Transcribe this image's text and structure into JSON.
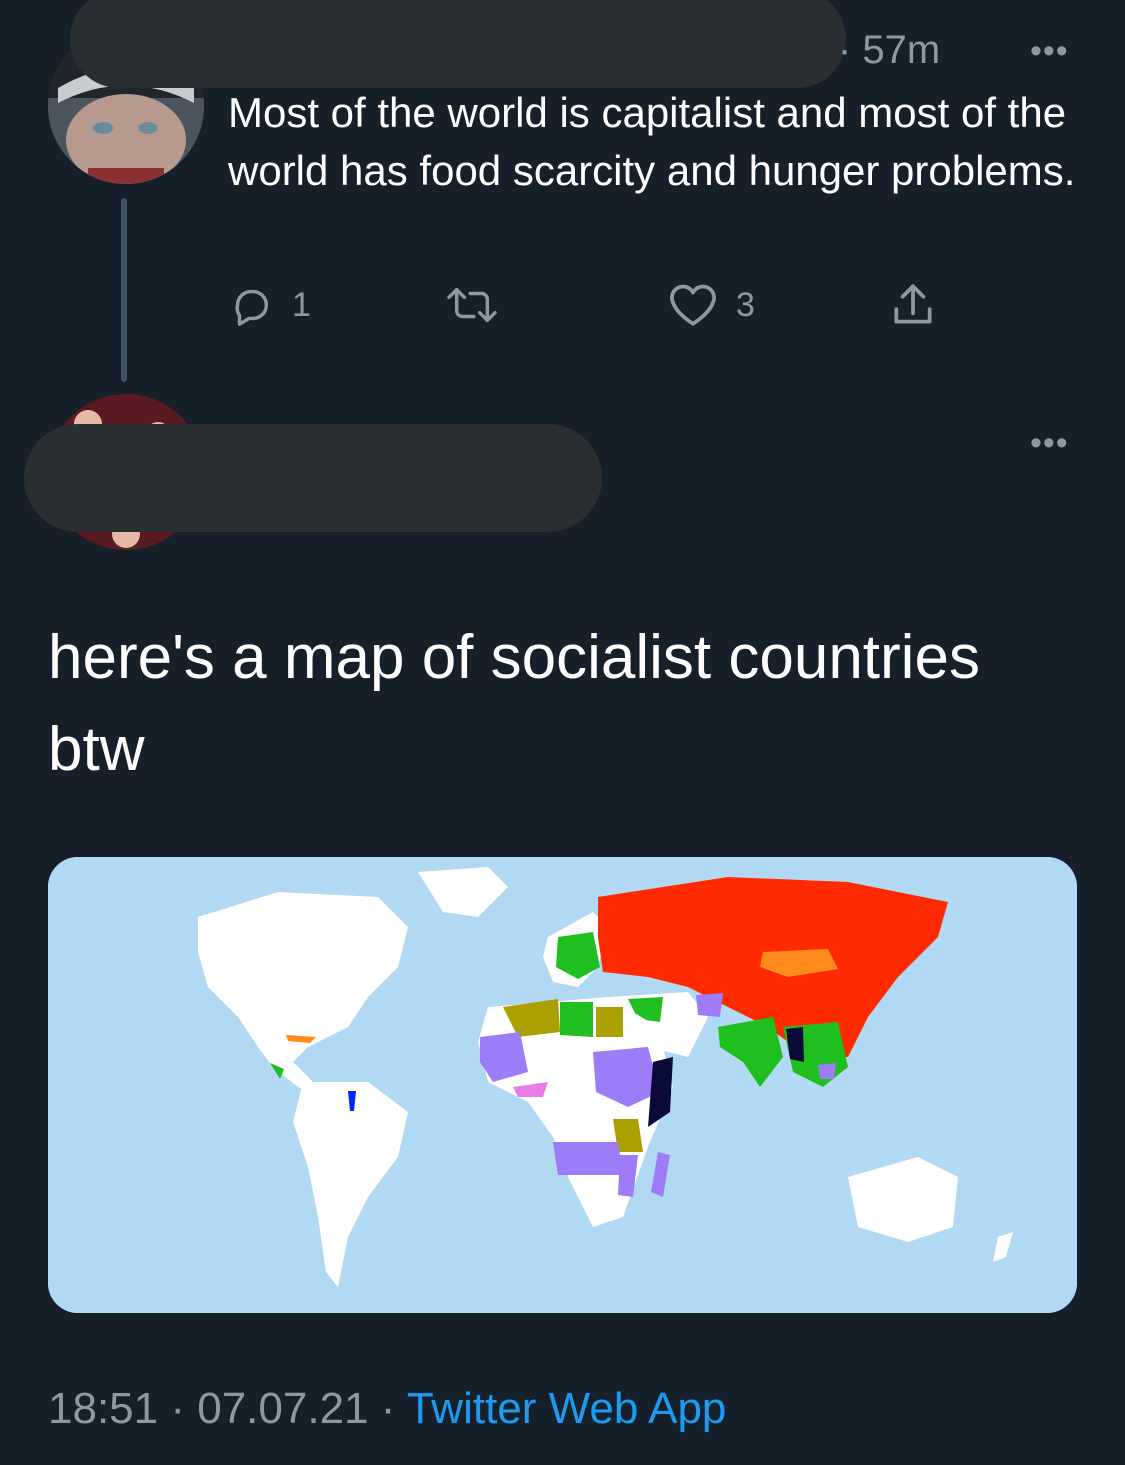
{
  "reply_to_tweet": {
    "timestamp": "· 57m",
    "more_glyph": "•••",
    "text": "Most of the world is capitalist and most of the world has food scarcity and hunger problems.",
    "actions": {
      "reply_count": "1",
      "retweet_count": "",
      "like_count": "3"
    }
  },
  "main_tweet": {
    "more_glyph": "•••",
    "text": "here's a map of socialist countries btw",
    "map_image": {
      "colors": {
        "ocean": "#b2d9f3",
        "land": "#ffffff",
        "red": "#ff2a00",
        "orange": "#ff8c1a",
        "green": "#1fbf1f",
        "olive": "#aaa000",
        "purple": "#9e7bf7",
        "pink": "#e87ce6",
        "navy": "#0a0a3a",
        "blue": "#0026ff"
      }
    },
    "time": "18:51",
    "separator": "·",
    "date": "07.07.21",
    "source": "Twitter Web App"
  }
}
